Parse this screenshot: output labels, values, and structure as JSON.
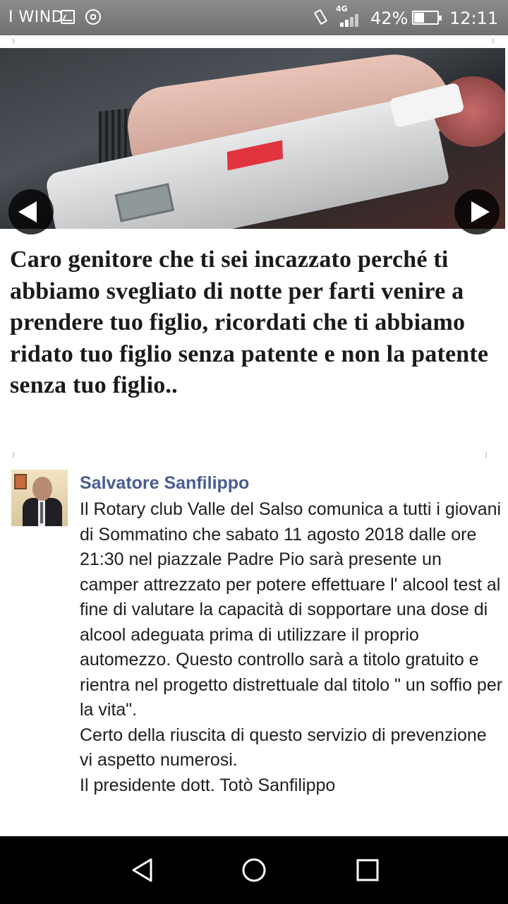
{
  "status_bar": {
    "carrier": "I WIND",
    "network": "4G",
    "battery": "42%",
    "time": "12:11",
    "icons": [
      "image-icon",
      "whatsapp-icon",
      "vibrate-icon",
      "signal-icon",
      "battery-icon"
    ]
  },
  "post": {
    "caption": "Caro genitore che ti sei incazzato perché ti abbiamo svegliato di notte per farti venire a prendere tuo figlio, ricordati che ti abbiamo ridato tuo figlio senza patente e non la patente senza tuo figlio..",
    "arrows": [
      "previous-arrow-icon",
      "next-arrow-icon"
    ]
  },
  "comment": {
    "author": "Salvatore Sanfilippo",
    "text": "Il Rotary club Valle del Salso comunica a tutti i giovani di Sommatino che sabato 11 agosto 2018 dalle ore 21:30 nel piazzale Padre Pio sarà presente un camper attrezzato per potere effettuare l' alcool test al fine di valutare la capacità di sopportare una dose di alcool adeguata prima di utilizzare il proprio automezzo. Questo controllo sarà a titolo gratuito e rientra nel progetto distrettuale dal titolo \" un soffio per la vita\".\nCerto della riuscita di questo servizio di prevenzione vi aspetto numerosi.\nIl presidente dott. Totò Sanfilippo"
  },
  "nav_bar": {
    "icons": [
      "back-icon",
      "home-icon",
      "recent-apps-icon"
    ]
  },
  "colors": {
    "status_bar": "#7d7d7d",
    "author_name": "#4a5d8f",
    "nav_bar": "#000000"
  }
}
